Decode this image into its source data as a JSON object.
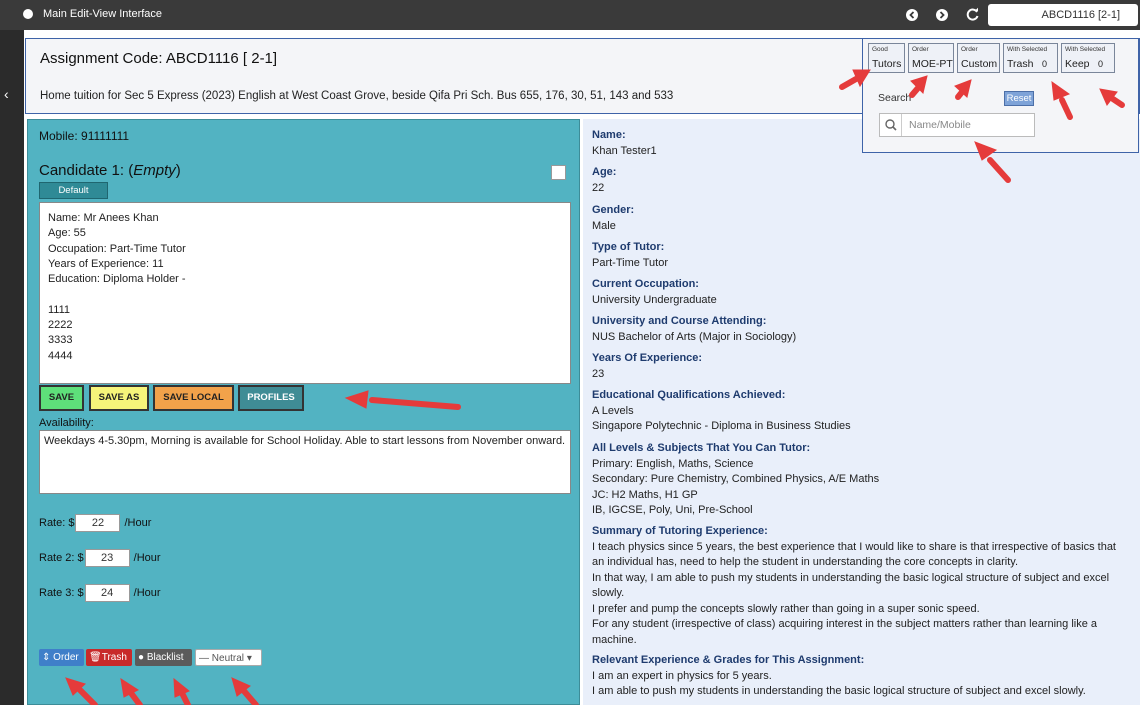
{
  "window": {
    "title": "Main Edit-View Interface",
    "selector_value": "ABCD1116 [2-1]"
  },
  "header": {
    "assignment_code": "Assignment Code: ABCD1116 [ 2-1]",
    "description": "Home tuition for Sec 5 Express (2023) English at West Coast Grove, beside Qifa Pri Sch. Bus 655, 176, 30, 51, 143 and 533"
  },
  "filter_panel": {
    "buttons": [
      {
        "small": "Good",
        "label": "Tutors"
      },
      {
        "small": "Order",
        "label": "MOE-PT"
      },
      {
        "small": "Order",
        "label": "Custom"
      },
      {
        "small": "With Selected",
        "label": "Trash",
        "count": "0"
      },
      {
        "small": "With Selected",
        "label": "Keep",
        "count": "0"
      }
    ],
    "search_label": "Search",
    "reset_label": "Reset",
    "search_placeholder": "Name/Mobile"
  },
  "candidate": {
    "mobile": "Mobile: 91111111",
    "title_prefix": "Candidate 1: (",
    "title_status": "Empty",
    "title_suffix": ")",
    "default_label": "Default",
    "profile_lines": [
      "Name: Mr Anees Khan",
      "Age: 55",
      "Occupation: Part-Time Tutor",
      "Years of Experience: 11",
      "Education: Diploma Holder -",
      "",
      "1111",
      "2222",
      "3333",
      "4444"
    ],
    "buttons": {
      "save": "SAVE",
      "save_as": "SAVE AS",
      "save_local": "SAVE LOCAL",
      "profiles": "PROFILES"
    },
    "availability_label": "Availability:",
    "availability_text": "Weekdays 4-5.30pm, Morning is available for School Holiday. Able to start lessons from November onward.",
    "rates": [
      {
        "label": "Rate: $",
        "value": "22",
        "unit": "/Hour"
      },
      {
        "label": "Rate 2: $",
        "value": "23",
        "unit": "/Hour"
      },
      {
        "label": "Rate 3: $",
        "value": "24",
        "unit": "/Hour"
      }
    ],
    "actions": {
      "order": "Order",
      "trash": "Trash",
      "blacklist": "Blacklist",
      "neutral": "Neutral"
    }
  },
  "details": {
    "name_label": "Name:",
    "name": "Khan Tester1",
    "age_label": "Age:",
    "age": "22",
    "gender_label": "Gender:",
    "gender": "Male",
    "type_label": "Type of Tutor:",
    "type": "Part-Time Tutor",
    "occupation_label": "Current Occupation:",
    "occupation": "University Undergraduate",
    "university_label": "University and Course Attending:",
    "university": "NUS Bachelor of Arts (Major in Sociology)",
    "experience_label": "Years Of Experience:",
    "experience": "23",
    "qualifications_label": "Educational Qualifications Achieved:",
    "qualifications": [
      "A Levels",
      "Singapore Polytechnic - Diploma in Business Studies"
    ],
    "levels_label": "All Levels & Subjects That You Can Tutor:",
    "levels": [
      "Primary: English, Maths, Science",
      "Secondary: Pure Chemistry, Combined Physics, A/E Maths",
      "JC: H2 Maths, H1 GP",
      "IB, IGCSE, Poly, Uni, Pre-School"
    ],
    "summary_label": "Summary of Tutoring Experience:",
    "summary": [
      "I teach physics since 5 years, the best experience that I would like to share is that irrespective of basics that",
      "an individual has, need to help the student in understanding the core concepts in clarity.",
      "In that way, I am able to push my students in understanding the basic logical structure of subject and excel",
      "slowly.",
      "I prefer and pump the concepts slowly rather than going in a super sonic speed.",
      "For any student (irrespective of class) acquiring interest in the subject matters rather than learning like a",
      "machine."
    ],
    "relevant_label": "Relevant Experience & Grades for This Assignment:",
    "relevant": [
      "I am an expert in physics for 5 years.",
      "I am able to push my students in understanding the basic logical structure of subject and excel slowly."
    ]
  },
  "colors": {
    "teal_panel": "#52b3c2",
    "save": "#5ee07a",
    "save_as": "#f6f47a",
    "save_local": "#f2a24a",
    "profiles": "#3f8c95",
    "order": "#3f7fc9",
    "trash": "#c82a2a",
    "blacklist": "#5b5b5b",
    "arrow": "#e53b3b"
  }
}
